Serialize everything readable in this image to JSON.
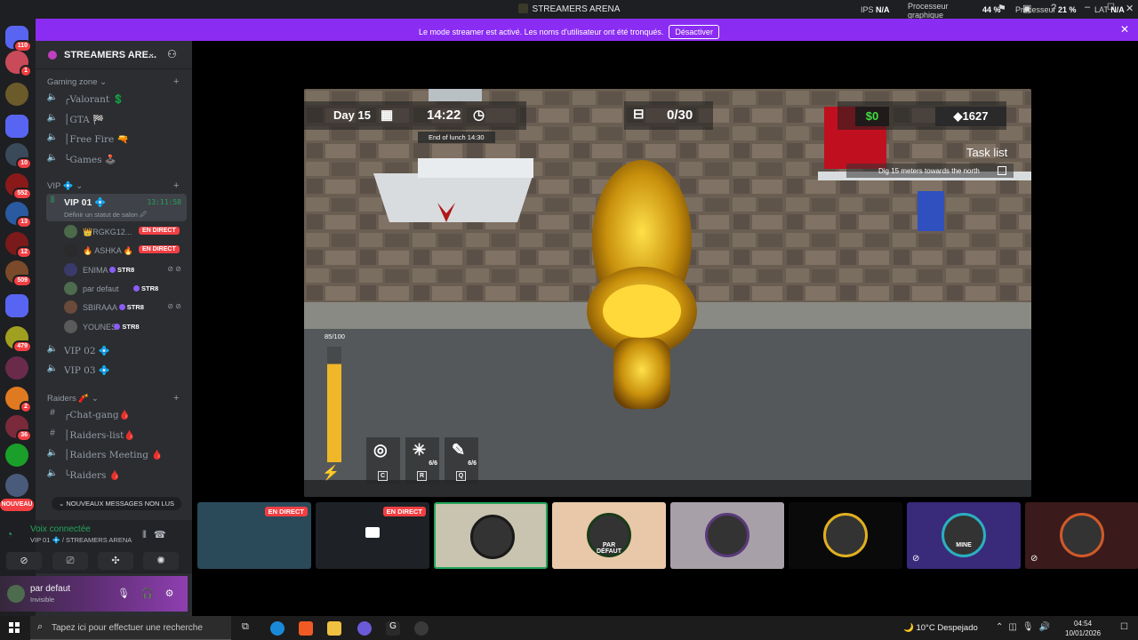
{
  "window": {
    "title": "STREAMERS ARENA",
    "stats": {
      "ips_label": "IPS",
      "ips_value": "N/A",
      "gpu_label_1": "Processeur",
      "gpu_label_2": "graphique",
      "gpu_value": "44 %",
      "cpu_label": "Processeur",
      "cpu_value": "21 %",
      "lat_label": "LAT",
      "lat_value": "N/A"
    }
  },
  "banner": {
    "message": "Le mode streamer est activé. Les noms d'utilisateur ont été tronqués.",
    "button": "Désactiver"
  },
  "guilds": [
    {
      "badge": "110",
      "color": "#5865f2"
    },
    {
      "badge": "1",
      "color": "#c94b5a"
    },
    {
      "badge": "",
      "color": "#6b5a2a"
    },
    {
      "badge": "",
      "color": "#5865f2"
    },
    {
      "badge": "10",
      "color": "#3a4a5a"
    },
    {
      "badge": "552",
      "color": "#8a1a1a"
    },
    {
      "badge": "13",
      "color": "#2a5aa0"
    },
    {
      "badge": "12",
      "color": "#7a1a1a"
    },
    {
      "badge": "509",
      "color": "#7a4a2a"
    },
    {
      "badge": "",
      "color": "#5865f2"
    },
    {
      "badge": "479",
      "color": "#a0a020"
    },
    {
      "badge": "",
      "color": "#6a2a4a"
    },
    {
      "badge": "2",
      "color": "#e07a20"
    },
    {
      "badge": "36",
      "color": "#7a2a3a"
    },
    {
      "badge": "",
      "color": "#1aa02a"
    },
    {
      "badge": "",
      "color": "#4a5a7a"
    }
  ],
  "nouveau": "NOUVEAU",
  "server": {
    "name": "STREAMERS ARE...",
    "categories": {
      "gaming": "Gaming zone",
      "vip": "VIP 💠",
      "raiders": "Raiders 🧨"
    },
    "gaming_channels": [
      "╭Valorant 💲",
      "│GTA 🏁",
      "│Free Fire 🔫",
      "╰Games 🕹️"
    ],
    "vip_active": {
      "name": "VIP 01 💠",
      "time": "13:11:58",
      "status": "Définir un statut de salon 🖉"
    },
    "users": [
      {
        "name": "👑RGKG12...",
        "live": "EN DIRECT",
        "str8": ""
      },
      {
        "name": "🔥 ASHKA 🔥",
        "live": "EN DIRECT",
        "str8": ""
      },
      {
        "name": "ENIMA",
        "live": "",
        "str8": "STR8"
      },
      {
        "name": "par defaut",
        "live": "",
        "str8": "STR8"
      },
      {
        "name": "SBIRAAA",
        "live": "",
        "str8": "STR8"
      },
      {
        "name": "YOUNES",
        "live": "",
        "str8": "STR8"
      }
    ],
    "vip_channels": [
      "VIP 02 💠",
      "VIP 03 💠"
    ],
    "raiders_channels": [
      "╭Chat-gang🩸",
      "│Raiders-list🩸",
      "│Raiders Meeting 🩸",
      "╰Raiders 🩸"
    ]
  },
  "new_messages": "⌄ NOUVEAUX MESSAGES NON LUS",
  "voice": {
    "status": "Voix connectée",
    "location": "VIP 01 💠 / STREAMERS ARENA"
  },
  "user": {
    "name": "par defaut",
    "status": "Invisible"
  },
  "game": {
    "day": "Day 15",
    "time": "14:22",
    "lunch": "End of lunch 14:30",
    "counter": "0/30",
    "money": "$0",
    "gems": "1627",
    "task_title": "Task list",
    "task": "Dig 15 meters towards the north",
    "energy": "85/100",
    "energy_level": 0.85,
    "slots": [
      {
        "key": "C",
        "count": ""
      },
      {
        "key": "R",
        "count": "6/6"
      },
      {
        "key": "Q",
        "count": "6/6"
      }
    ]
  },
  "stream_tiles": [
    {
      "live": "EN DIRECT",
      "bg": "#2a4a5a",
      "ring": "",
      "text": ""
    },
    {
      "live": "EN DIRECT",
      "bg": "#1e2226",
      "ring": "",
      "text": ""
    },
    {
      "live": "",
      "bg": "#c8c4b0",
      "ring": "#1a1a1a",
      "text": ""
    },
    {
      "live": "",
      "bg": "#e8c8a8",
      "ring": "#1a3a1a",
      "text": "PAR DÉFAUT"
    },
    {
      "live": "",
      "bg": "#a8a0a8",
      "ring": "#5a3a7a",
      "text": ""
    },
    {
      "live": "",
      "bg": "#0a0a0a",
      "ring": "#e0b020",
      "text": ""
    },
    {
      "live": "",
      "bg": "#3a2a7a",
      "ring": "#2ab0c0",
      "text": "MINE"
    },
    {
      "live": "",
      "bg": "#3a1a1a",
      "ring": "#d05a2a",
      "text": ""
    }
  ],
  "taskbar": {
    "search_placeholder": "Tapez ici pour effectuer une recherche",
    "weather": "10°C  Despejado",
    "time": "04:54",
    "date": "10/01/2026"
  }
}
